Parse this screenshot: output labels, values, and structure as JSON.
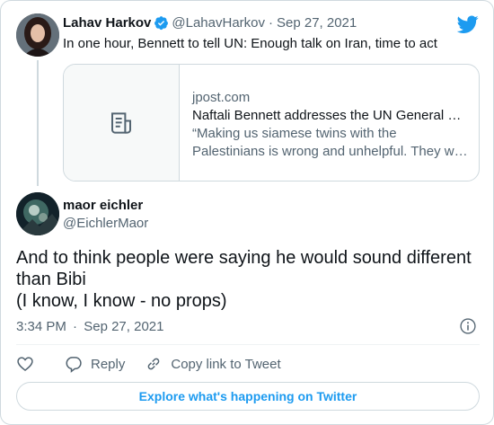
{
  "quoted_tweet": {
    "author_name": "Lahav Harkov",
    "handle": "@LahavHarkov",
    "separator": "·",
    "date": "Sep 27, 2021",
    "text": "In one hour, Bennett to tell UN: Enough talk on Iran, time to act",
    "link_card": {
      "domain": "jpost.com",
      "title": "Naftali Bennett addresses the UN General …",
      "description_line1": "“Making us siamese twins with the",
      "description_line2": "Palestinians is wrong and unhelpful. They w…",
      "thumbnail_icon": "article-icon"
    }
  },
  "tweet": {
    "author_name": "maor eichler",
    "handle": "@EichlerMaor",
    "text_lines": [
      "And to think people were saying he would sound different",
      "than Bibi",
      "(I know, I know - no props)"
    ],
    "time": "3:34 PM",
    "separator": "·",
    "date": "Sep 27, 2021"
  },
  "actions": {
    "like_icon": "heart-icon",
    "reply_label": "Reply",
    "copy_link_label": "Copy link to Tweet"
  },
  "explore_label": "Explore what's happening on Twitter",
  "colors": {
    "accent": "#1d9bf0",
    "text_primary": "#0f1419",
    "text_secondary": "#536471",
    "border": "#cfd9de"
  }
}
